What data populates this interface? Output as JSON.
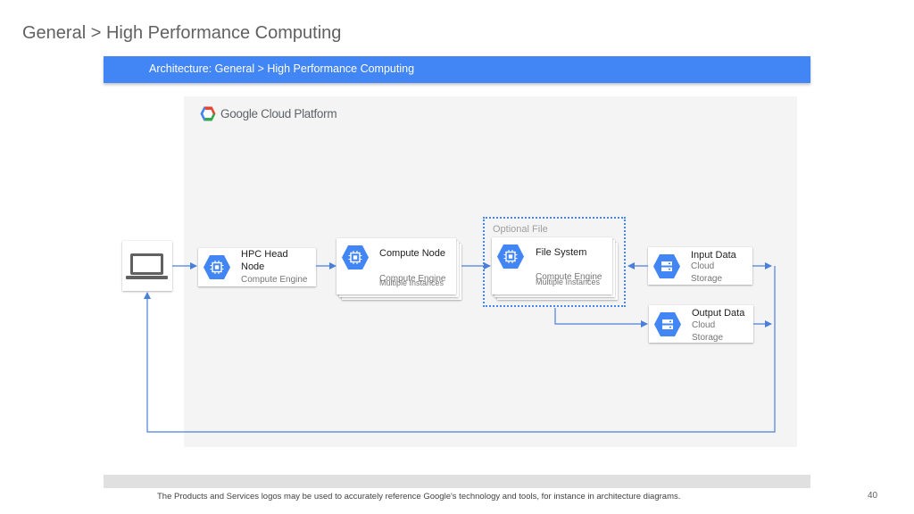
{
  "header": {
    "title": "General > High Performance Computing",
    "banner": "Architecture: General > High Performance Computing"
  },
  "platform": {
    "logo_text": "Google Cloud Platform"
  },
  "nodes": {
    "client": {
      "icon": "laptop-icon"
    },
    "hpc_head": {
      "title_line1": "HPC Head",
      "title_line2": "Node",
      "subtitle": "Compute Engine",
      "icon": "compute-engine-icon"
    },
    "compute_node": {
      "title": "Compute Node",
      "subtitle": "Compute Engine",
      "subtitle2": "Multiple Instances",
      "icon": "compute-engine-icon"
    },
    "file_system": {
      "title": "File System",
      "subtitle": "Compute Engine",
      "subtitle2": "Multiple Instances",
      "icon": "compute-engine-icon"
    },
    "input_data": {
      "title": "Input Data",
      "subtitle_line1": "Cloud",
      "subtitle_line2": "Storage",
      "icon": "cloud-storage-icon"
    },
    "output_data": {
      "title": "Output Data",
      "subtitle_line1": "Cloud",
      "subtitle_line2": "Storage",
      "icon": "cloud-storage-icon"
    }
  },
  "groups": {
    "optional": {
      "label": "Optional File"
    }
  },
  "footer": {
    "note": "The Products and Services logos may be used to accurately reference Google's technology and tools, for instance in architecture diagrams.",
    "page_number": "40"
  },
  "colors": {
    "accent": "#4285f4",
    "connector": "#4a7fd9",
    "canvas": "#f4f4f4"
  }
}
